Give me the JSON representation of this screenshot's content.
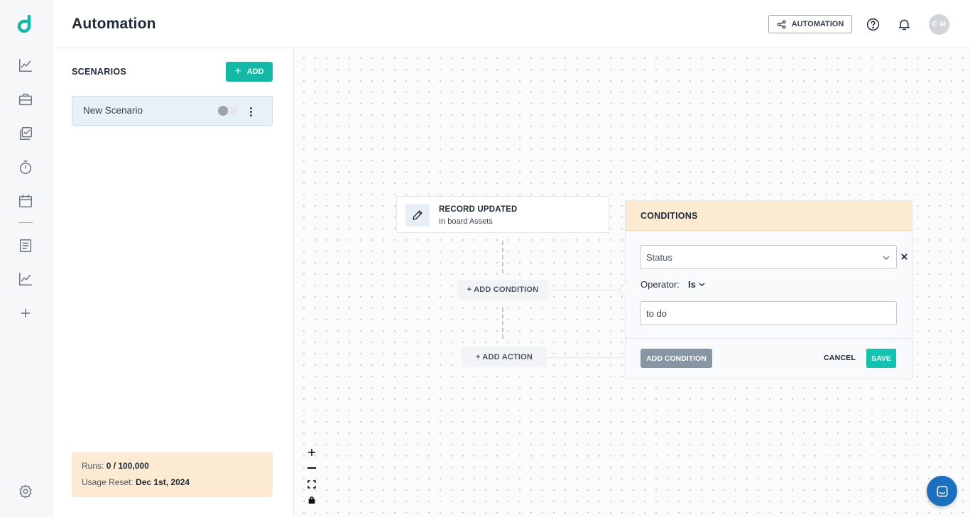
{
  "header": {
    "title": "Automation",
    "automation_button": "AUTOMATION",
    "avatar_initials": "C M"
  },
  "sidebar": {
    "icons": [
      "analytics-icon",
      "briefcase-icon",
      "checklist-icon",
      "timer-icon",
      "calendar-icon",
      "document-icon",
      "chart-icon",
      "plus-icon"
    ],
    "bottom_icon": "settings-icon"
  },
  "scenarios": {
    "title": "SCENARIOS",
    "add_label": "ADD",
    "items": [
      {
        "name": "New Scenario",
        "enabled": false
      }
    ],
    "usage": {
      "runs_label": "Runs:",
      "runs_value": "0 / 100,000",
      "reset_label": "Usage Reset:",
      "reset_value": "Dec 1st, 2024"
    }
  },
  "canvas": {
    "trigger": {
      "title": "RECORD UPDATED",
      "subtitle": "In board Assets"
    },
    "add_condition": "+ ADD CONDITION",
    "add_action": "+ ADD ACTION",
    "conditions": {
      "title": "CONDITIONS",
      "field_value": "Status",
      "operator_label": "Operator:",
      "operator_value": "Is",
      "value": "to do",
      "add_condition_button": "ADD CONDITION",
      "cancel_button": "CANCEL",
      "save_button": "SAVE"
    }
  },
  "colors": {
    "brand": "#14b8a6",
    "conditions_header": "#fcebd2",
    "chat": "#1c6fbf"
  }
}
